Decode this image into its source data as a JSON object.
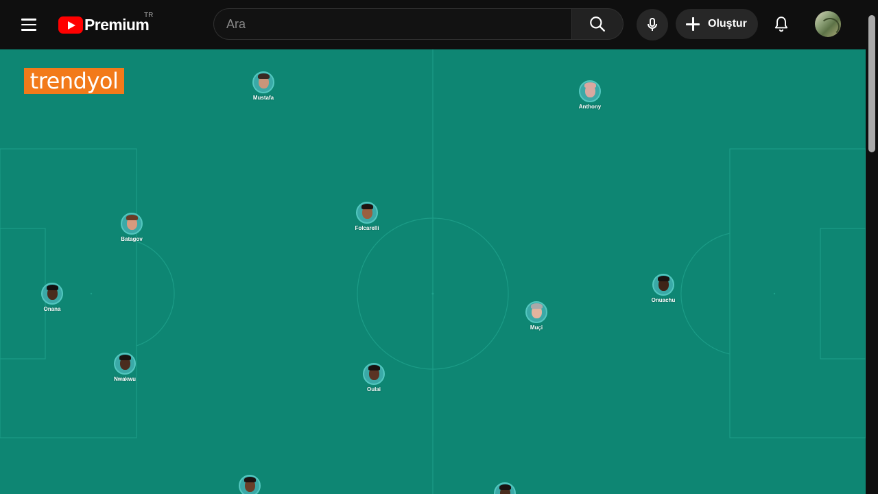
{
  "header": {
    "logo_text": "Premium",
    "region_code": "TR",
    "search": {
      "placeholder": "Ara",
      "value": ""
    },
    "create_label": "Oluştur",
    "icons": {
      "menu": "hamburger-menu-icon",
      "search": "search-icon",
      "mic": "microphone-icon",
      "create": "plus-icon",
      "notifications": "bell-icon"
    }
  },
  "video": {
    "brand_logo_text": "trendyol",
    "players": [
      {
        "name": "Mustafa",
        "skin": "#c9957a",
        "hair": "#3a2a22"
      },
      {
        "name": "Anthony",
        "skin": "#d9a8a0",
        "hair": "#d9a8a0"
      },
      {
        "name": "Batagov",
        "skin": "#d79a7e",
        "hair": "#6a3b26"
      },
      {
        "name": "Folcarelli",
        "skin": "#9a6040",
        "hair": "#1e1410"
      },
      {
        "name": "Onana",
        "skin": "#4a2c1e",
        "hair": "#141010"
      },
      {
        "name": "Onuachu",
        "skin": "#3e2418",
        "hair": "#1a1210"
      },
      {
        "name": "Muçi",
        "skin": "#e2b49e",
        "hair": "#a9a9a9"
      },
      {
        "name": "Nwakwu",
        "skin": "#4a2c1e",
        "hair": "#1a1410"
      },
      {
        "name": "Oulai",
        "skin": "#5a3424",
        "hair": "#1a1210"
      },
      {
        "name": "",
        "skin": "#6a3e28",
        "hair": "#1a1210"
      },
      {
        "name": "",
        "skin": "#4a2c1e",
        "hair": "#1a1210"
      }
    ]
  },
  "colors": {
    "pitch": "#0e8673",
    "brand": "#f27a1a",
    "youtube_red": "#ff0000"
  }
}
